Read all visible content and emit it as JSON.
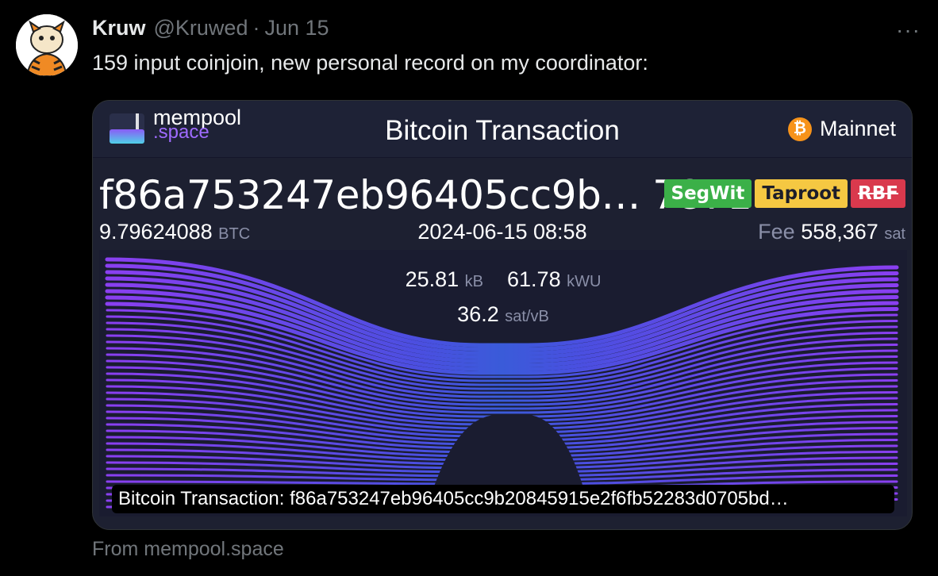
{
  "tweet": {
    "display_name": "Kruw",
    "handle": "@Kruwed",
    "separator": "·",
    "date": "Jun 15",
    "more_icon": "more-icon",
    "text": "159 input coinjoin, new personal record on my coordinator:"
  },
  "card": {
    "logo_main": "mempool",
    "logo_sub": ".space",
    "title": "Bitcoin Transaction",
    "network_icon_glyph": "₿",
    "network": "Mainnet",
    "txid": "f86a753247eb96405cc9b… 7871",
    "badges": {
      "segwit": "SegWit",
      "taproot": "Taproot",
      "rbf": "RBF"
    },
    "amount": "9.79624088",
    "amount_unit": "BTC",
    "timestamp": "2024-06-15 08:58",
    "fee_label": "Fee",
    "fee_value": "558,367",
    "fee_unit": "sat",
    "size": "25.81",
    "size_unit": "kB",
    "weight": "61.78",
    "weight_unit": "kWU",
    "feerate": "36.2",
    "feerate_unit": "sat/vB",
    "caption": "Bitcoin Transaction: f86a753247eb96405cc9b20845915e2f6fb52283d0705bd…"
  },
  "source": "From mempool.space",
  "colors": {
    "accent_purple": "#9f4dff",
    "flow_blue": "#3a5bd9",
    "card_bg": "#1d2031"
  }
}
